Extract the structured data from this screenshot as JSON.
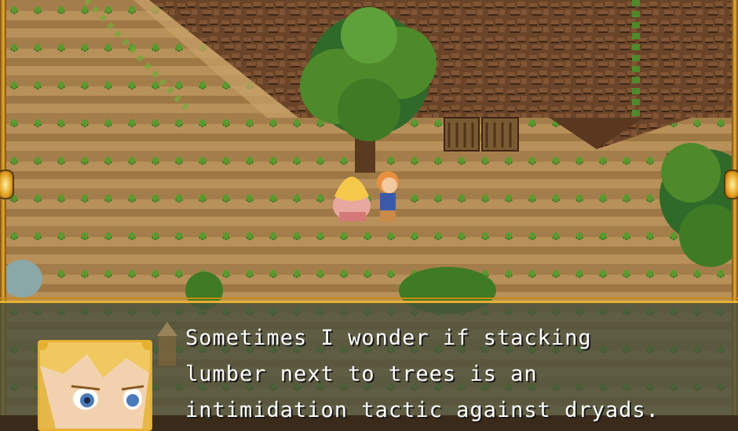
{
  "dialog": {
    "text": "Sometimes I wonder if stacking\nlumber next to trees is an\nintimidation tactic against dryads."
  },
  "portrait": {
    "icon": "blonde-character-portrait"
  },
  "colors": {
    "frame_gold": "#e8b030",
    "dialog_bg": "#464e3c",
    "text": "#ffffff",
    "soil": "#b08a52",
    "cliff": "#6a4428",
    "crop": "#4e8a2a"
  }
}
